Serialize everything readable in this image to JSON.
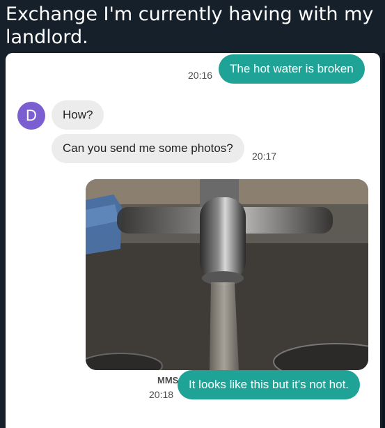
{
  "post": {
    "title": "Exchange I'm currently having with my landlord."
  },
  "conversation": {
    "avatar_letter": "D",
    "messages": [
      {
        "direction": "sent",
        "text": "The hot water is broken",
        "time": "20:16"
      },
      {
        "direction": "received",
        "text": "How?"
      },
      {
        "direction": "received",
        "text": "Can you send me some photos?",
        "time": "20:17"
      },
      {
        "direction": "sent",
        "type": "mms",
        "label": "MMS",
        "text": "It looks like this but it's not hot.",
        "time": "20:18"
      }
    ]
  },
  "colors": {
    "page_background": "#15202b",
    "sent_bubble": "#1fa396",
    "received_bubble": "#ececec",
    "avatar": "#7b5fd0"
  },
  "icons": [
    "photo-faucet"
  ]
}
